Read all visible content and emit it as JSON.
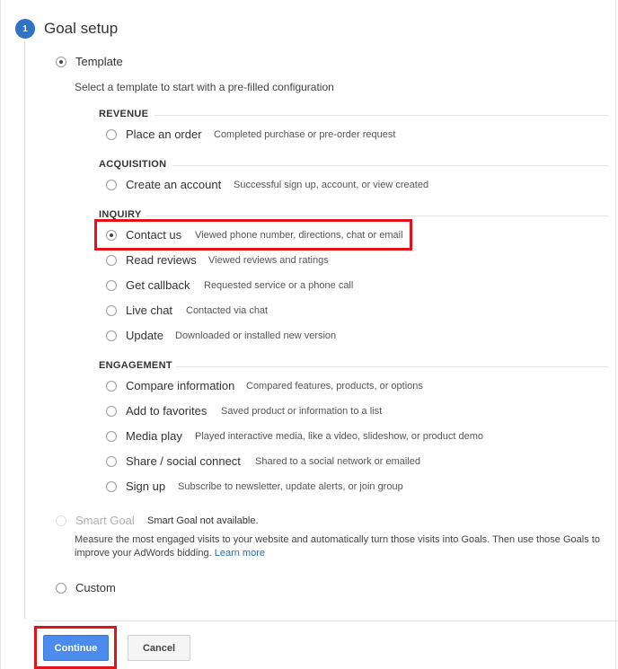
{
  "step": {
    "number": "1",
    "title": "Goal setup"
  },
  "template": {
    "label": "Template",
    "intro": "Select a template to start with a pre-filled configuration"
  },
  "categories": {
    "revenue": "REVENUE",
    "acquisition": "ACQUISITION",
    "inquiry": "INQUIRY",
    "engagement": "ENGAGEMENT"
  },
  "options": {
    "place_order": {
      "label": "Place an order",
      "desc": "Completed purchase or pre-order request"
    },
    "create_account": {
      "label": "Create an account",
      "desc": "Successful sign up, account, or view created"
    },
    "contact_us": {
      "label": "Contact us",
      "desc": "Viewed phone number, directions, chat or email"
    },
    "read_reviews": {
      "label": "Read reviews",
      "desc": "Viewed reviews and ratings"
    },
    "get_callback": {
      "label": "Get callback",
      "desc": "Requested service or a phone call"
    },
    "live_chat": {
      "label": "Live chat",
      "desc": "Contacted via chat"
    },
    "update": {
      "label": "Update",
      "desc": "Downloaded or installed new version"
    },
    "compare_info": {
      "label": "Compare information",
      "desc": "Compared features, products, or options"
    },
    "add_favorites": {
      "label": "Add to favorites",
      "desc": "Saved product or information to a list"
    },
    "media_play": {
      "label": "Media play",
      "desc": "Played interactive media, like a video, slideshow, or product demo"
    },
    "share_social": {
      "label": "Share / social connect",
      "desc": "Shared to a social network or emailed"
    },
    "sign_up": {
      "label": "Sign up",
      "desc": "Subscribe to newsletter, update alerts, or join group"
    }
  },
  "smart_goal": {
    "label": "Smart Goal",
    "status": "Smart Goal not available.",
    "description": "Measure the most engaged visits to your website and automatically turn those visits into Goals. Then use those Goals to improve your AdWords bidding.",
    "learn_more": "Learn more"
  },
  "custom": {
    "label": "Custom"
  },
  "buttons": {
    "continue": "Continue",
    "cancel": "Cancel"
  }
}
